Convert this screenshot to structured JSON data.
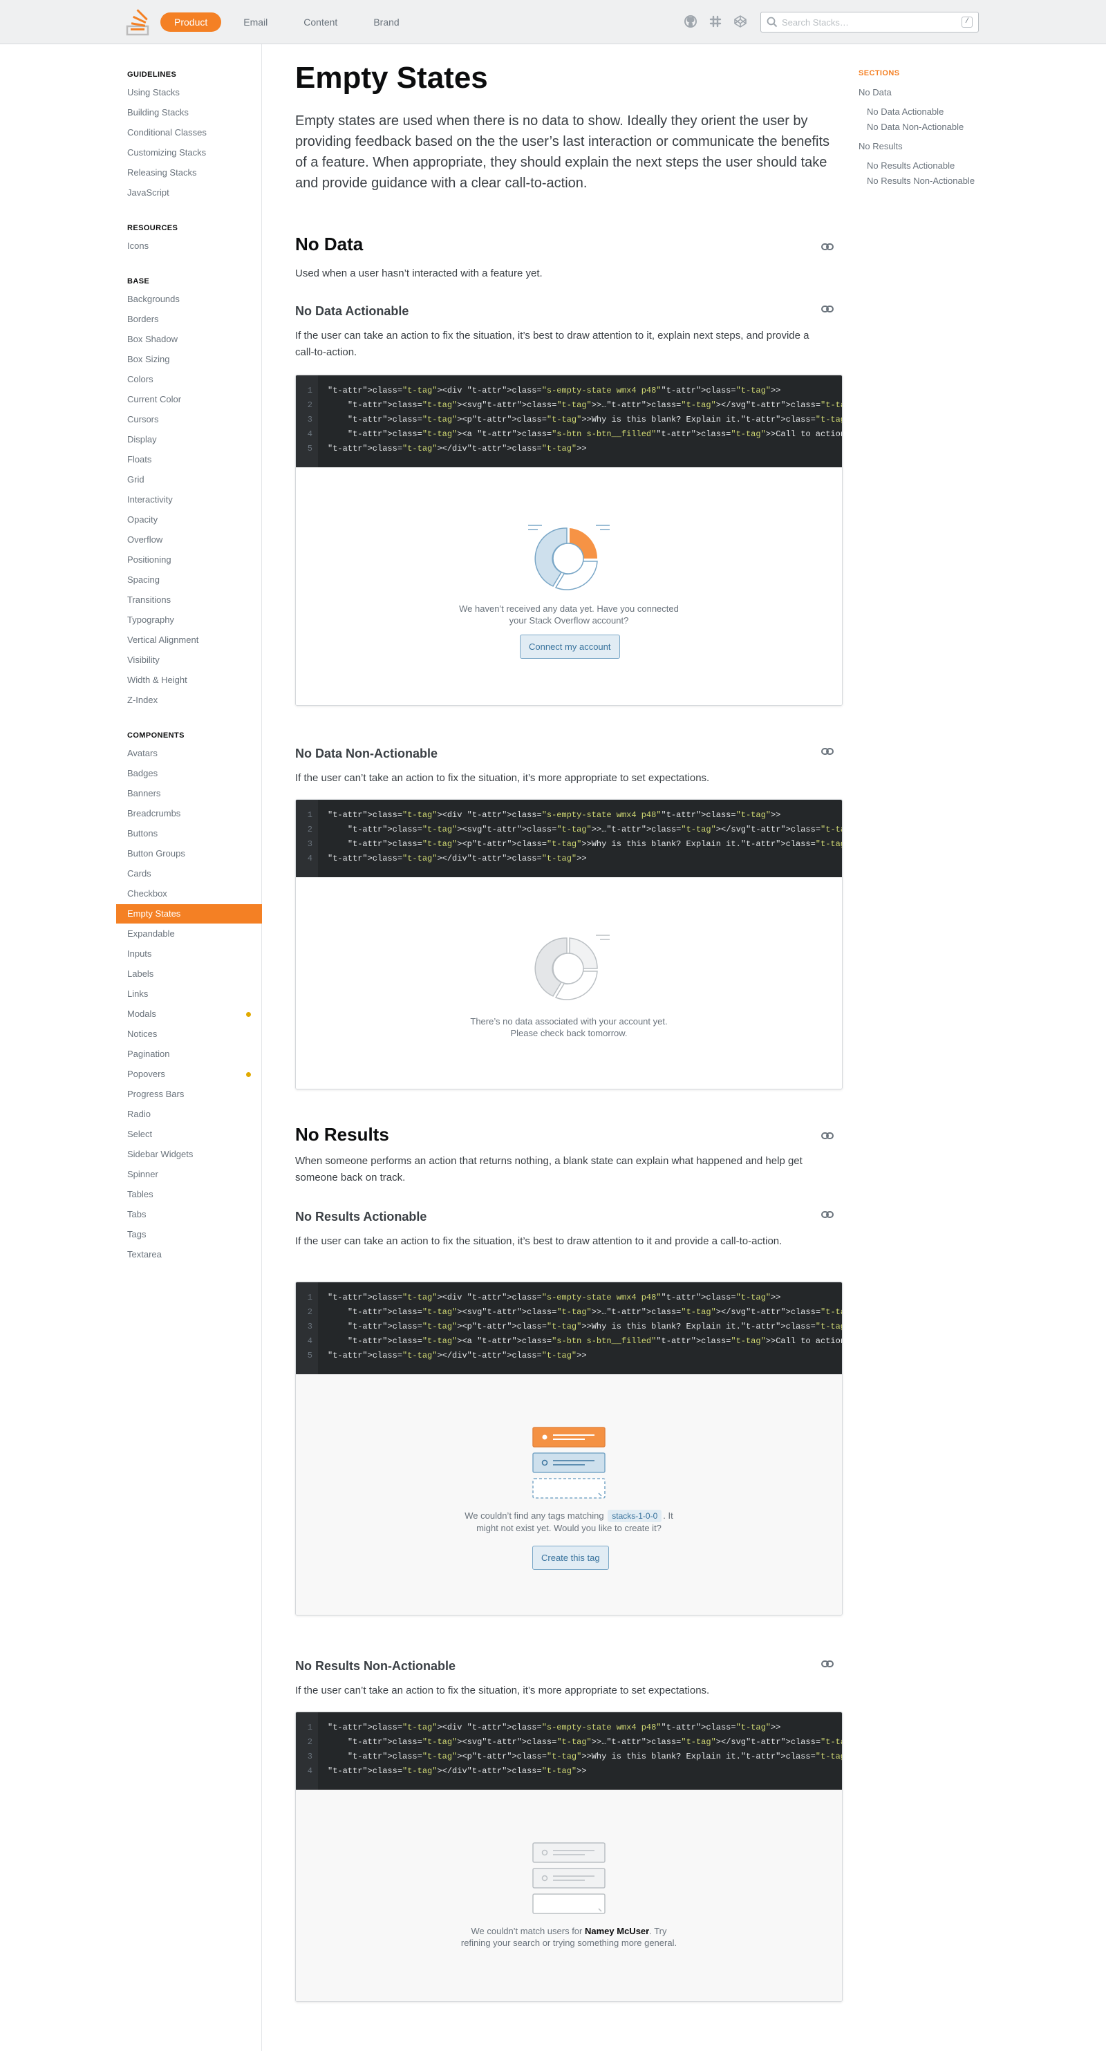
{
  "header": {
    "nav": [
      "Product",
      "Email",
      "Content",
      "Brand"
    ],
    "icons": [
      "github-icon",
      "slack-icon",
      "codepen-icon"
    ],
    "search_placeholder": "Search Stacks…",
    "search_shortcut": "/"
  },
  "sidebar": {
    "groups": [
      {
        "heading": "GUIDELINES",
        "items": [
          "Using Stacks",
          "Building Stacks",
          "Conditional Classes",
          "Customizing Stacks",
          "Releasing Stacks",
          "JavaScript"
        ]
      },
      {
        "heading": "RESOURCES",
        "items": [
          "Icons"
        ]
      },
      {
        "heading": "BASE",
        "items": [
          "Backgrounds",
          "Borders",
          "Box Shadow",
          "Box Sizing",
          "Colors",
          "Current Color",
          "Cursors",
          "Display",
          "Floats",
          "Grid",
          "Interactivity",
          "Opacity",
          "Overflow",
          "Positioning",
          "Spacing",
          "Transitions",
          "Typography",
          "Vertical Alignment",
          "Visibility",
          "Width & Height",
          "Z-Index"
        ]
      },
      {
        "heading": "COMPONENTS",
        "items": [
          "Avatars",
          "Badges",
          "Banners",
          "Breadcrumbs",
          "Buttons",
          "Button Groups",
          "Cards",
          "Checkbox",
          "Empty States",
          "Expandable",
          "Inputs",
          "Labels",
          "Links",
          "Modals",
          "Notices",
          "Pagination",
          "Popovers",
          "Progress Bars",
          "Radio",
          "Select",
          "Sidebar Widgets",
          "Spinner",
          "Tables",
          "Tabs",
          "Tags",
          "Textarea"
        ]
      }
    ],
    "active": "Empty States",
    "dotted": [
      "Modals",
      "Popovers"
    ]
  },
  "page": {
    "title": "Empty States",
    "intro": "Empty states are used when there is no data to show. Ideally they orient the user by providing feedback based on the the user’s last interaction or communicate the benefits of a feature. When appropriate, they should explain the next steps the user should take and provide guidance with a clear call-to-action.",
    "no_data": {
      "heading": "No Data",
      "desc": "Used when a user hasn’t interacted with a feature yet.",
      "actionable": {
        "heading": "No Data Actionable",
        "desc": "If the user can take an action to fix the situation, it’s best to draw attention to it, explain next steps, and provide a call-to-action.",
        "message_line1": "We haven’t received any data yet. Have you connected",
        "message_line2": "your Stack Overflow account?",
        "button": "Connect my account"
      },
      "non_actionable": {
        "heading": "No Data Non-Actionable",
        "desc": "If the user can’t take an action to fix the situation, it’s more appropriate to set expectations.",
        "message_line1": "There’s no data associated with your account yet.",
        "message_line2": "Please check back tomorrow."
      }
    },
    "no_results": {
      "heading": "No Results",
      "desc": "When someone performs an action that returns nothing, a blank state can explain what happened and help get someone back on track.",
      "actionable": {
        "heading": "No Results Actionable",
        "desc": "If the user can take an action to fix the situation, it’s best to draw attention to it and provide a call-to-action.",
        "message_pre": "We couldn’t find any tags matching",
        "tag": "stacks-1-0-0",
        "message_post": ". It",
        "message_line2": "might not exist yet. Would you like to create it?",
        "button": "Create this tag"
      },
      "non_actionable": {
        "heading": "No Results Non-Actionable",
        "desc": "If the user can’t take an action to fix the situation, it’s more appropriate to set expectations.",
        "message_pre": "We couldn’t match users for",
        "name": "Namey McUser",
        "message_post": ". Try",
        "message_line2": "refining your search or trying something more general."
      }
    }
  },
  "code": {
    "actionable": [
      "<div class=\"s-empty-state wmx4 p48\">",
      "    <svg>…</svg>",
      "    <p>Why is this blank? Explain it.</p>",
      "    <a class=\"s-btn s-btn__filled\">Call to action</a>",
      "</div>"
    ],
    "non_actionable": [
      "<div class=\"s-empty-state wmx4 p48\">",
      "    <svg>…</svg>",
      "    <p>Why is this blank? Explain it.</p>",
      "</div>"
    ]
  },
  "toc": {
    "heading": "SECTIONS",
    "items": [
      {
        "label": "No Data",
        "level": 1
      },
      {
        "label": "No Data Actionable",
        "level": 2
      },
      {
        "label": "No Data Non-Actionable",
        "level": 2
      },
      {
        "label": "No Results",
        "level": 1
      },
      {
        "label": "No Results Actionable",
        "level": 2
      },
      {
        "label": "No Results Non-Actionable",
        "level": 2
      }
    ]
  },
  "colors": {
    "accent": "#f48024",
    "code_bg": "#242729",
    "link_blue": "#39739d"
  }
}
